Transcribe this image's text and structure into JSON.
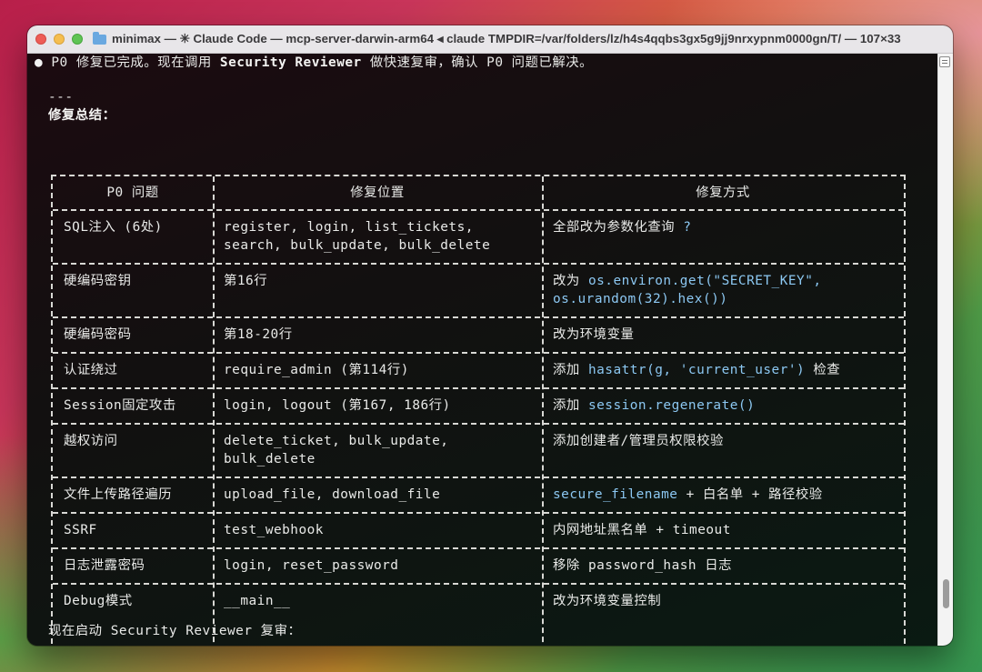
{
  "window": {
    "title": "minimax — ✳ Claude Code — mcp-server-darwin-arm64 ◂ claude TMPDIR=/var/folders/lz/h4s4qqbs3gx5g9jj9nrxypnm0000gn/T/ — 107×33"
  },
  "terminal": {
    "line1_prefix": "P0 修复已完成。现在调用 ",
    "line1_bold": "Security Reviewer",
    "line1_suffix": " 做快速复审，确认 P0 问题已解决。",
    "separator": "---",
    "summary_heading": "修复总结：",
    "bottom_line": "现在启动 Security Reviewer 复审：",
    "bullet": "●"
  },
  "table": {
    "headers": [
      "P0 问题",
      "修复位置",
      "修复方式"
    ],
    "rows": [
      {
        "issue": "SQL注入 (6处)",
        "location": [
          "register, login, list_tickets,",
          "search, bulk_update, bulk_delete"
        ],
        "fix": [
          [
            {
              "t": "全部改为参数化查询 ",
              "hl": false
            },
            {
              "t": "?",
              "hl": true
            }
          ]
        ]
      },
      {
        "issue": "硬编码密钥",
        "location": [
          "第16行"
        ],
        "fix": [
          [
            {
              "t": "改为 ",
              "hl": false
            },
            {
              "t": "os.environ.get(\"SECRET_KEY\",",
              "hl": true
            }
          ],
          [
            {
              "t": "os.urandom(32).hex())",
              "hl": true
            }
          ]
        ]
      },
      {
        "issue": "硬编码密码",
        "location": [
          "第18-20行"
        ],
        "fix": [
          [
            {
              "t": "改为环境变量",
              "hl": false
            }
          ]
        ]
      },
      {
        "issue": "认证绕过",
        "location": [
          "require_admin (第114行)"
        ],
        "fix": [
          [
            {
              "t": "添加 ",
              "hl": false
            },
            {
              "t": "hasattr(g, 'current_user')",
              "hl": true
            },
            {
              "t": " 检查",
              "hl": false
            }
          ]
        ]
      },
      {
        "issue": "Session固定攻击",
        "location": [
          "login, logout (第167, 186行)"
        ],
        "fix": [
          [
            {
              "t": "添加 ",
              "hl": false
            },
            {
              "t": "session.regenerate()",
              "hl": true
            }
          ]
        ]
      },
      {
        "issue": "越权访问",
        "location": [
          "delete_ticket, bulk_update,",
          "bulk_delete"
        ],
        "fix": [
          [
            {
              "t": "添加创建者/管理员权限校验",
              "hl": false
            }
          ]
        ]
      },
      {
        "issue": "文件上传路径遍历",
        "location": [
          "upload_file, download_file"
        ],
        "fix": [
          [
            {
              "t": "secure_filename",
              "hl": true
            },
            {
              "t": " + 白名单 + 路径校验",
              "hl": false
            }
          ]
        ]
      },
      {
        "issue": "SSRF",
        "location": [
          "test_webhook"
        ],
        "fix": [
          [
            {
              "t": "内网地址黑名单 + timeout",
              "hl": false
            }
          ]
        ]
      },
      {
        "issue": "日志泄露密码",
        "location": [
          "login, reset_password"
        ],
        "fix": [
          [
            {
              "t": "移除 password_hash 日志",
              "hl": false
            }
          ]
        ]
      },
      {
        "issue": "Debug模式",
        "location": [
          "__main__"
        ],
        "location_hl": true,
        "fix": [
          [
            {
              "t": "改为环境变量控制",
              "hl": false
            }
          ]
        ]
      }
    ]
  },
  "colors": {
    "text": "#e9eae8",
    "highlight": "#8cc8f2",
    "border": "#d8d8d4"
  }
}
